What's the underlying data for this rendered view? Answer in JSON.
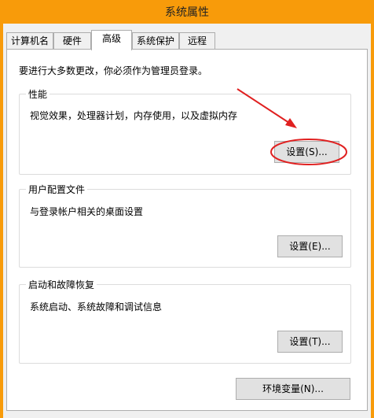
{
  "window": {
    "title": "系统属性"
  },
  "tabs": [
    {
      "label": "计算机名"
    },
    {
      "label": "硬件"
    },
    {
      "label": "高级",
      "active": true
    },
    {
      "label": "系统保护"
    },
    {
      "label": "远程"
    }
  ],
  "admin_note": "要进行大多数更改，你必须作为管理员登录。",
  "performance": {
    "title": "性能",
    "desc": "视觉效果，处理器计划，内存使用，以及虚拟内存",
    "button": "设置(S)..."
  },
  "user_profiles": {
    "title": "用户配置文件",
    "desc": "与登录帐户相关的桌面设置",
    "button": "设置(E)..."
  },
  "startup_recovery": {
    "title": "启动和故障恢复",
    "desc": "系统启动、系统故障和调试信息",
    "button": "设置(T)..."
  },
  "env_button": "环境变量(N)...",
  "colors": {
    "frame": "#f89b0a",
    "annotation": "#e02020"
  }
}
